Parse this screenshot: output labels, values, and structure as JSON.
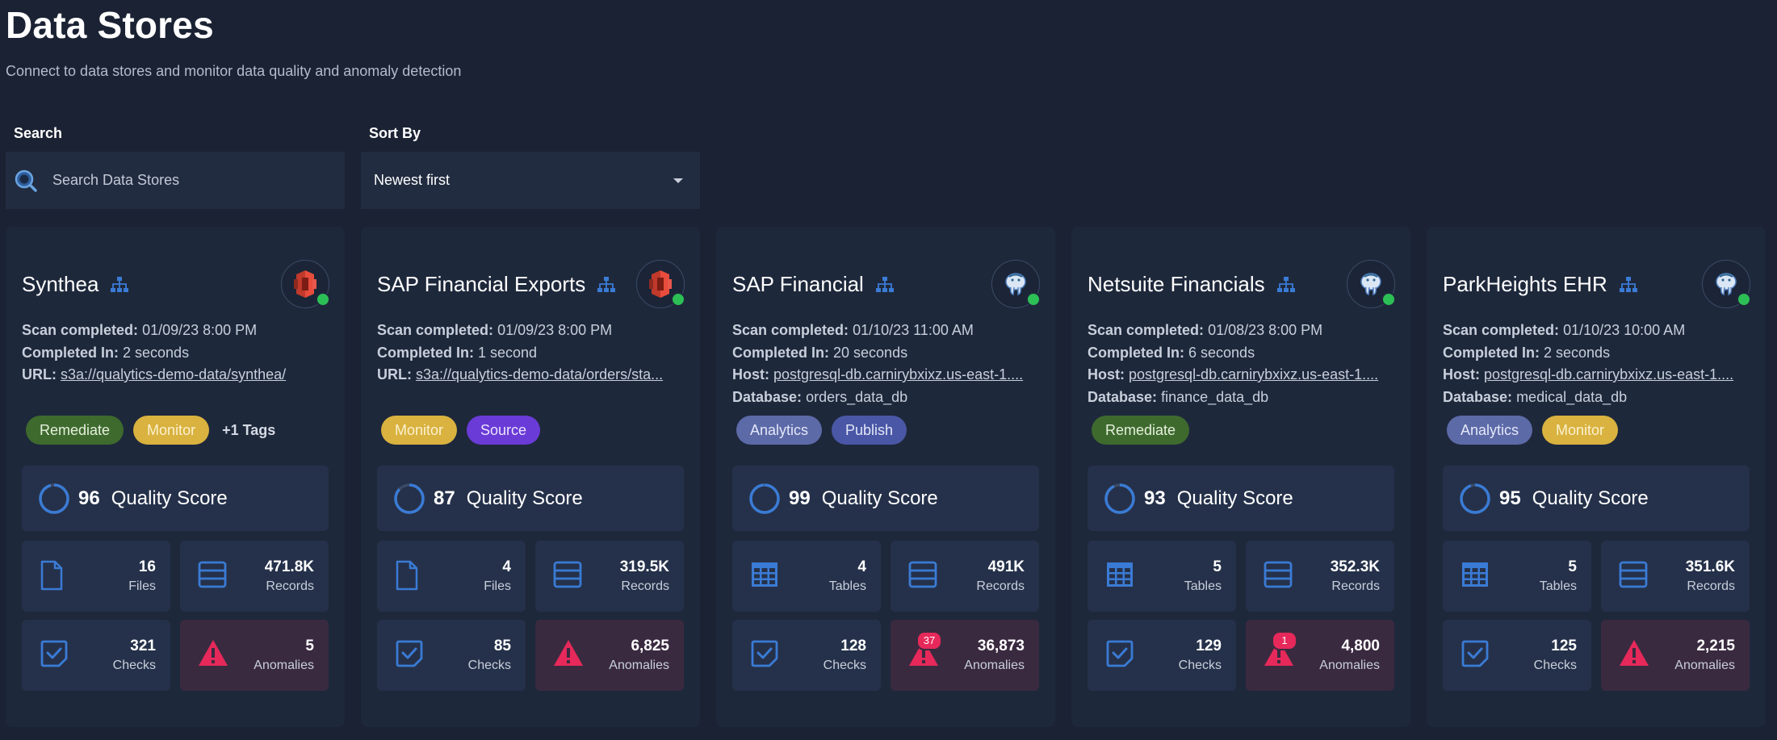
{
  "page": {
    "title": "Data Stores",
    "subtitle": "Connect to data stores and monitor data quality and anomaly detection"
  },
  "search": {
    "label": "Search",
    "placeholder": "Search Data Stores"
  },
  "sort": {
    "label": "Sort By",
    "value": "Newest first"
  },
  "colors": {
    "tag_remediate": "#3e6a2e",
    "tag_monitor": "#d9b23f",
    "tag_source": "#6a3bd6",
    "tag_analytics": "#5d6aa8",
    "tag_publish": "#4a57a6",
    "status_ok": "#2cbf55",
    "anomaly": "#e6295a",
    "accent_blue": "#3a7bd5"
  },
  "cards": [
    {
      "title": "Synthea",
      "logo_icon": "amazon-s3-icon",
      "meta": [
        {
          "label": "Scan completed:",
          "value": "01/09/23 8:00 PM",
          "link": false
        },
        {
          "label": "Completed In:",
          "value": "2 seconds",
          "link": false
        },
        {
          "label": "URL:",
          "value": "s3a://qualytics-demo-data/synthea/",
          "link": true
        }
      ],
      "tags": [
        "Remediate",
        "Monitor"
      ],
      "tags_more": "+1 Tags",
      "quality_score": "96",
      "quality_label": "Quality Score",
      "quality_fraction": 0.96,
      "stats": [
        {
          "value": "16",
          "label": "Files",
          "icon": "file-icon"
        },
        {
          "value": "471.8K",
          "label": "Records",
          "icon": "records-icon"
        },
        {
          "value": "321",
          "label": "Checks",
          "icon": "check-icon"
        },
        {
          "value": "5",
          "label": "Anomalies",
          "icon": "warning-icon",
          "badge": ""
        }
      ]
    },
    {
      "title": "SAP Financial Exports",
      "logo_icon": "amazon-s3-icon",
      "meta": [
        {
          "label": "Scan completed:",
          "value": "01/09/23 8:00 PM",
          "link": false
        },
        {
          "label": "Completed In:",
          "value": "1 second",
          "link": false
        },
        {
          "label": "URL:",
          "value": "s3a://qualytics-demo-data/orders/sta...",
          "link": true
        }
      ],
      "tags": [
        "Monitor",
        "Source"
      ],
      "tags_more": "",
      "quality_score": "87",
      "quality_label": "Quality Score",
      "quality_fraction": 0.87,
      "stats": [
        {
          "value": "4",
          "label": "Files",
          "icon": "file-icon"
        },
        {
          "value": "319.5K",
          "label": "Records",
          "icon": "records-icon"
        },
        {
          "value": "85",
          "label": "Checks",
          "icon": "check-icon"
        },
        {
          "value": "6,825",
          "label": "Anomalies",
          "icon": "warning-icon",
          "badge": ""
        }
      ]
    },
    {
      "title": "SAP Financial",
      "logo_icon": "postgresql-icon",
      "meta": [
        {
          "label": "Scan completed:",
          "value": "01/10/23 11:00 AM",
          "link": false
        },
        {
          "label": "Completed In:",
          "value": "20 seconds",
          "link": false
        },
        {
          "label": "Host:",
          "value": "postgresql-db.carnirybxixz.us-east-1....",
          "link": true
        },
        {
          "label": "Database:",
          "value": "orders_data_db",
          "link": false
        }
      ],
      "tags": [
        "Analytics",
        "Publish"
      ],
      "tags_more": "",
      "quality_score": "99",
      "quality_label": "Quality Score",
      "quality_fraction": 0.99,
      "stats": [
        {
          "value": "4",
          "label": "Tables",
          "icon": "table-icon"
        },
        {
          "value": "491K",
          "label": "Records",
          "icon": "records-icon"
        },
        {
          "value": "128",
          "label": "Checks",
          "icon": "check-icon"
        },
        {
          "value": "36,873",
          "label": "Anomalies",
          "icon": "warning-icon",
          "badge": "37"
        }
      ]
    },
    {
      "title": "Netsuite Financials",
      "logo_icon": "postgresql-icon",
      "meta": [
        {
          "label": "Scan completed:",
          "value": "01/08/23 8:00 PM",
          "link": false
        },
        {
          "label": "Completed In:",
          "value": "6 seconds",
          "link": false
        },
        {
          "label": "Host:",
          "value": "postgresql-db.carnirybxixz.us-east-1....",
          "link": true
        },
        {
          "label": "Database:",
          "value": "finance_data_db",
          "link": false
        }
      ],
      "tags": [
        "Remediate"
      ],
      "tags_more": "",
      "quality_score": "93",
      "quality_label": "Quality Score",
      "quality_fraction": 0.93,
      "stats": [
        {
          "value": "5",
          "label": "Tables",
          "icon": "table-icon"
        },
        {
          "value": "352.3K",
          "label": "Records",
          "icon": "records-icon"
        },
        {
          "value": "129",
          "label": "Checks",
          "icon": "check-icon"
        },
        {
          "value": "4,800",
          "label": "Anomalies",
          "icon": "warning-icon",
          "badge": "1"
        }
      ]
    },
    {
      "title": "ParkHeights EHR",
      "logo_icon": "postgresql-icon",
      "meta": [
        {
          "label": "Scan completed:",
          "value": "01/10/23 10:00 AM",
          "link": false
        },
        {
          "label": "Completed In:",
          "value": "2 seconds",
          "link": false
        },
        {
          "label": "Host:",
          "value": "postgresql-db.carnirybxixz.us-east-1....",
          "link": true
        },
        {
          "label": "Database:",
          "value": "medical_data_db",
          "link": false
        }
      ],
      "tags": [
        "Analytics",
        "Monitor"
      ],
      "tags_more": "",
      "quality_score": "95",
      "quality_label": "Quality Score",
      "quality_fraction": 0.95,
      "stats": [
        {
          "value": "5",
          "label": "Tables",
          "icon": "table-icon"
        },
        {
          "value": "351.6K",
          "label": "Records",
          "icon": "records-icon"
        },
        {
          "value": "125",
          "label": "Checks",
          "icon": "check-icon"
        },
        {
          "value": "2,215",
          "label": "Anomalies",
          "icon": "warning-icon",
          "badge": ""
        }
      ]
    }
  ]
}
